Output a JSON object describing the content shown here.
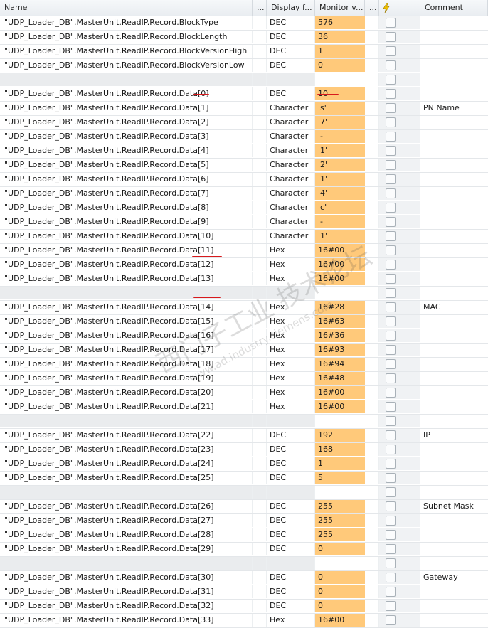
{
  "columns": {
    "name": "Name",
    "dots1": "...",
    "display": "Display f...",
    "monitor": "Monitor v...",
    "dots2": "...",
    "comment": "Comment"
  },
  "rows": [
    {
      "name": "\"UDP_Loader_DB\".MasterUnit.ReadIP.Record.BlockType",
      "fmt": "DEC",
      "val": "576",
      "comment": ""
    },
    {
      "name": "\"UDP_Loader_DB\".MasterUnit.ReadIP.Record.BlockLength",
      "fmt": "DEC",
      "val": "36",
      "comment": ""
    },
    {
      "name": "\"UDP_Loader_DB\".MasterUnit.ReadIP.Record.BlockVersionHigh",
      "fmt": "DEC",
      "val": "1",
      "comment": ""
    },
    {
      "name": "\"UDP_Loader_DB\".MasterUnit.ReadIP.Record.BlockVersionLow",
      "fmt": "DEC",
      "val": "0",
      "comment": ""
    },
    {
      "empty": true
    },
    {
      "name": "\"UDP_Loader_DB\".MasterUnit.ReadIP.Record.Data[0]",
      "fmt": "DEC",
      "val": "10",
      "comment": ""
    },
    {
      "name": "\"UDP_Loader_DB\".MasterUnit.ReadIP.Record.Data[1]",
      "fmt": "Character",
      "val": "'s'",
      "comment": "PN Name"
    },
    {
      "name": "\"UDP_Loader_DB\".MasterUnit.ReadIP.Record.Data[2]",
      "fmt": "Character",
      "val": "'7'",
      "comment": ""
    },
    {
      "name": "\"UDP_Loader_DB\".MasterUnit.ReadIP.Record.Data[3]",
      "fmt": "Character",
      "val": "'-'",
      "comment": ""
    },
    {
      "name": "\"UDP_Loader_DB\".MasterUnit.ReadIP.Record.Data[4]",
      "fmt": "Character",
      "val": "'1'",
      "comment": ""
    },
    {
      "name": "\"UDP_Loader_DB\".MasterUnit.ReadIP.Record.Data[5]",
      "fmt": "Character",
      "val": "'2'",
      "comment": ""
    },
    {
      "name": "\"UDP_Loader_DB\".MasterUnit.ReadIP.Record.Data[6]",
      "fmt": "Character",
      "val": "'1'",
      "comment": ""
    },
    {
      "name": "\"UDP_Loader_DB\".MasterUnit.ReadIP.Record.Data[7]",
      "fmt": "Character",
      "val": "'4'",
      "comment": ""
    },
    {
      "name": "\"UDP_Loader_DB\".MasterUnit.ReadIP.Record.Data[8]",
      "fmt": "Character",
      "val": "'c'",
      "comment": ""
    },
    {
      "name": "\"UDP_Loader_DB\".MasterUnit.ReadIP.Record.Data[9]",
      "fmt": "Character",
      "val": "'-'",
      "comment": ""
    },
    {
      "name": "\"UDP_Loader_DB\".MasterUnit.ReadIP.Record.Data[10]",
      "fmt": "Character",
      "val": "'1'",
      "comment": ""
    },
    {
      "name": "\"UDP_Loader_DB\".MasterUnit.ReadIP.Record.Data[11]",
      "fmt": "Hex",
      "val": "16#00",
      "comment": ""
    },
    {
      "name": "\"UDP_Loader_DB\".MasterUnit.ReadIP.Record.Data[12]",
      "fmt": "Hex",
      "val": "16#00",
      "comment": ""
    },
    {
      "name": "\"UDP_Loader_DB\".MasterUnit.ReadIP.Record.Data[13]",
      "fmt": "Hex",
      "val": "16#00",
      "comment": ""
    },
    {
      "empty": true
    },
    {
      "name": "\"UDP_Loader_DB\".MasterUnit.ReadIP.Record.Data[14]",
      "fmt": "Hex",
      "val": "16#28",
      "comment": "MAC"
    },
    {
      "name": "\"UDP_Loader_DB\".MasterUnit.ReadIP.Record.Data[15]",
      "fmt": "Hex",
      "val": "16#63",
      "comment": ""
    },
    {
      "name": "\"UDP_Loader_DB\".MasterUnit.ReadIP.Record.Data[16]",
      "fmt": "Hex",
      "val": "16#36",
      "comment": ""
    },
    {
      "name": "\"UDP_Loader_DB\".MasterUnit.ReadIP.Record.Data[17]",
      "fmt": "Hex",
      "val": "16#93",
      "comment": ""
    },
    {
      "name": "\"UDP_Loader_DB\".MasterUnit.ReadIP.Record.Data[18]",
      "fmt": "Hex",
      "val": "16#94",
      "comment": ""
    },
    {
      "name": "\"UDP_Loader_DB\".MasterUnit.ReadIP.Record.Data[19]",
      "fmt": "Hex",
      "val": "16#48",
      "comment": ""
    },
    {
      "name": "\"UDP_Loader_DB\".MasterUnit.ReadIP.Record.Data[20]",
      "fmt": "Hex",
      "val": "16#00",
      "comment": ""
    },
    {
      "name": "\"UDP_Loader_DB\".MasterUnit.ReadIP.Record.Data[21]",
      "fmt": "Hex",
      "val": "16#00",
      "comment": ""
    },
    {
      "empty": true
    },
    {
      "name": "\"UDP_Loader_DB\".MasterUnit.ReadIP.Record.Data[22]",
      "fmt": "DEC",
      "val": "192",
      "comment": "IP"
    },
    {
      "name": "\"UDP_Loader_DB\".MasterUnit.ReadIP.Record.Data[23]",
      "fmt": "DEC",
      "val": "168",
      "comment": ""
    },
    {
      "name": "\"UDP_Loader_DB\".MasterUnit.ReadIP.Record.Data[24]",
      "fmt": "DEC",
      "val": "1",
      "comment": ""
    },
    {
      "name": "\"UDP_Loader_DB\".MasterUnit.ReadIP.Record.Data[25]",
      "fmt": "DEC",
      "val": "5",
      "comment": ""
    },
    {
      "empty": true
    },
    {
      "name": "\"UDP_Loader_DB\".MasterUnit.ReadIP.Record.Data[26]",
      "fmt": "DEC",
      "val": "255",
      "comment": "Subnet Mask"
    },
    {
      "name": "\"UDP_Loader_DB\".MasterUnit.ReadIP.Record.Data[27]",
      "fmt": "DEC",
      "val": "255",
      "comment": ""
    },
    {
      "name": "\"UDP_Loader_DB\".MasterUnit.ReadIP.Record.Data[28]",
      "fmt": "DEC",
      "val": "255",
      "comment": ""
    },
    {
      "name": "\"UDP_Loader_DB\".MasterUnit.ReadIP.Record.Data[29]",
      "fmt": "DEC",
      "val": "0",
      "comment": ""
    },
    {
      "empty": true
    },
    {
      "name": "\"UDP_Loader_DB\".MasterUnit.ReadIP.Record.Data[30]",
      "fmt": "DEC",
      "val": "0",
      "comment": "Gateway"
    },
    {
      "name": "\"UDP_Loader_DB\".MasterUnit.ReadIP.Record.Data[31]",
      "fmt": "DEC",
      "val": "0",
      "comment": ""
    },
    {
      "name": "\"UDP_Loader_DB\".MasterUnit.ReadIP.Record.Data[32]",
      "fmt": "DEC",
      "val": "0",
      "comment": ""
    },
    {
      "name": "\"UDP_Loader_DB\".MasterUnit.ReadIP.Record.Data[33]",
      "fmt": "Hex",
      "val": "16#00",
      "comment": ""
    }
  ],
  "colors": {
    "monitor_bg": "#ffc97a",
    "annotation": "#d8191c",
    "flash_icon": "#f2c200"
  },
  "icons": {
    "header_modify": "lightning-icon",
    "row_checkbox": "checkbox-icon"
  },
  "watermark": {
    "cn": "西门子工业 技术论坛",
    "en": "www.ad.industry.siemens.com"
  }
}
